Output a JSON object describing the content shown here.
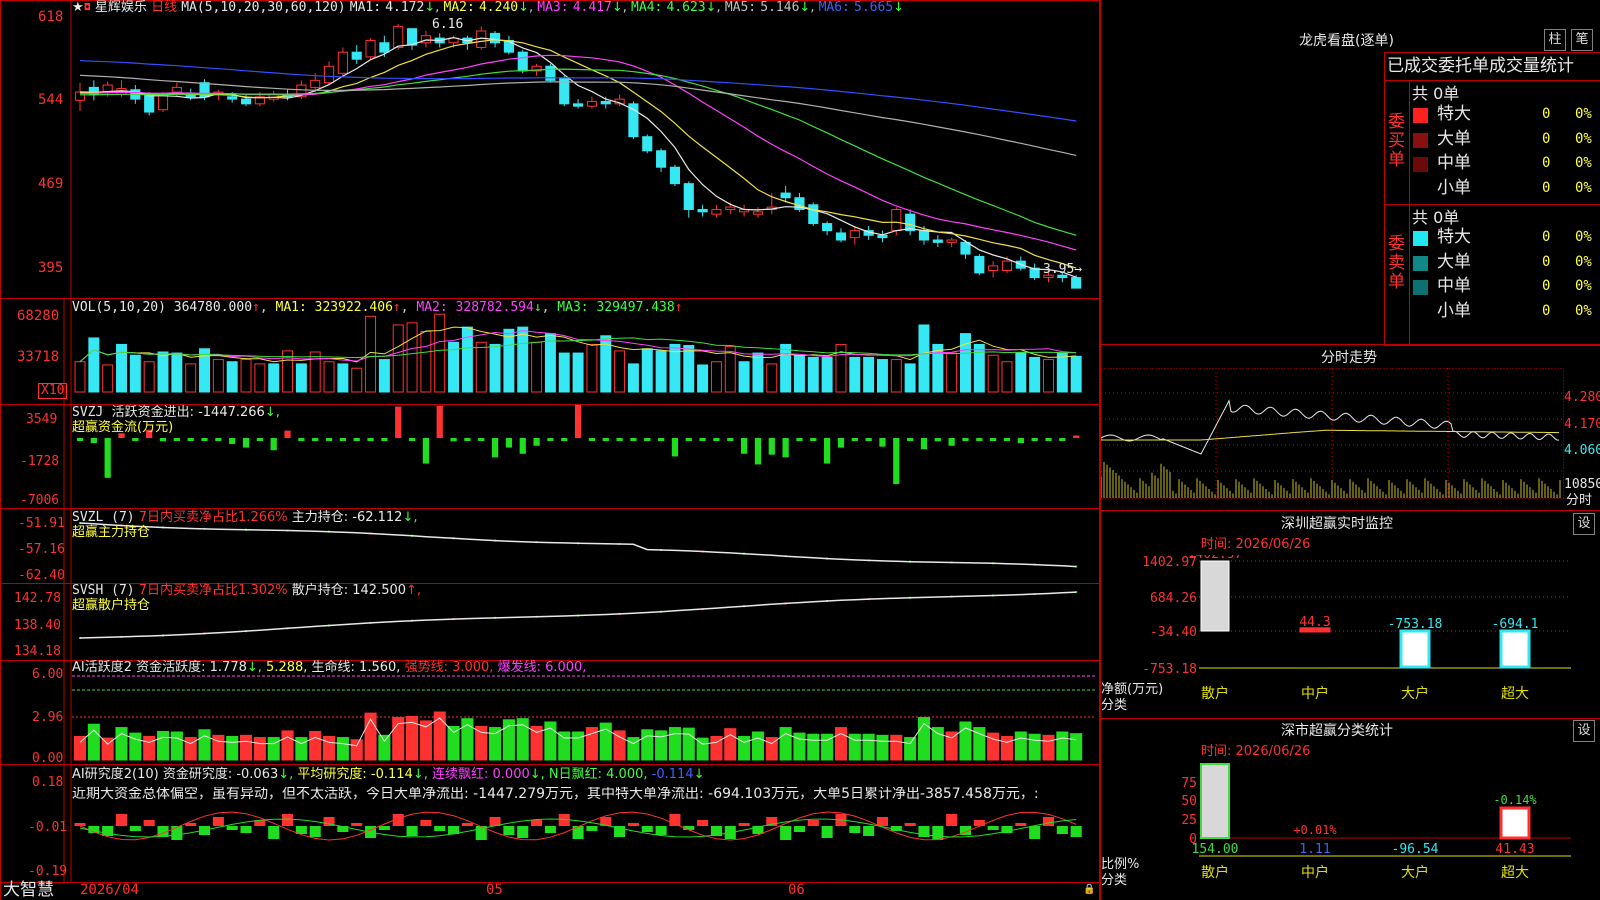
{
  "colors": {
    "up": "#ff3232",
    "down": "#36e8f4",
    "ma1": "#e8e8e8",
    "ma2": "#f0e040",
    "ma3": "#ff40ff",
    "ma4": "#40dd40",
    "ma5": "#b0b0b0",
    "ma6": "#3050ff",
    "grid": "#c00000",
    "bg": "#000000"
  },
  "stock": {
    "name": "星辉娱乐",
    "period": "日线"
  },
  "kline": {
    "ma_label": "MA(5,10,20,30,60,120)",
    "ma": [
      {
        "label": "MA1:",
        "value": "4.172",
        "arrow": "↓"
      },
      {
        "label": "MA2:",
        "value": "4.240",
        "arrow": "↓"
      },
      {
        "label": "MA3:",
        "value": "4.417",
        "arrow": "↓"
      },
      {
        "label": "MA4:",
        "value": "4.623",
        "arrow": "↓"
      },
      {
        "label": "MA5:",
        "value": "5.146",
        "arrow": "↓"
      },
      {
        "label": "MA6:",
        "value": "5.665",
        "arrow": "↓"
      }
    ],
    "high_mark": "6.16",
    "low_mark": "3.95→",
    "y_ticks": [
      "618",
      "544",
      "469",
      "395"
    ]
  },
  "vol": {
    "label": "VOL(5,10,20)",
    "value": "364780.000",
    "arrow": "↑",
    "ma1": "MA1: 323922.406",
    "ma1_arrow": "↑",
    "ma2": "MA2: 328782.594",
    "ma2_arrow": "↓",
    "ma3": "MA3: 329497.438",
    "ma3_arrow": "↑",
    "y_ticks": [
      "68280",
      "33718"
    ],
    "unit": "X10"
  },
  "svzj": {
    "label": "SVZJ",
    "sub": "活跃资金进出: -1447.266",
    "arrow": "↓,",
    "title2": "超赢资金流(万元)",
    "y_ticks": [
      "3549",
      "-1728",
      "-7006"
    ]
  },
  "svzl": {
    "label": "SVZL (7)",
    "text1": "7日内买卖净占比1.266%",
    "text2": "主力持仓: -62.112",
    "arrow": "↓,",
    "title2": "超赢主力持仓",
    "y_ticks": [
      "-51.91",
      "-57.16",
      "-62.40"
    ]
  },
  "svsh": {
    "label": "SVSH (7)",
    "text1": "7日内买卖净占比1.302%",
    "text2": "散户持仓: 142.500",
    "arrow": "↑,",
    "title2": "超赢散户持仓",
    "y_ticks": [
      "142.78",
      "138.40",
      "134.18"
    ]
  },
  "ai_act": {
    "label": "AI活跃度2",
    "t1": "资金活跃度: 1.778",
    "a1": "↓,",
    "t2": "5.288,",
    "t3": "生命线: 1.560,",
    "t4": "强势线: 3.000,",
    "t5": "爆发线: 6.000,",
    "y_ticks": [
      "6.00",
      "2.96",
      "0.00"
    ]
  },
  "ai_res": {
    "label": "AI研究度2(10)",
    "t1": "资金研究度: -0.063",
    "a1": "↓,",
    "t2": "平均研究度: -0.114",
    "a2": "↓,",
    "t3": "连续飘红: 0.000",
    "a3": "↓,",
    "t4": "N日飘红: 4.000,",
    "t5": "-0.114",
    "a5": "↓",
    "desc": "近期大资金总体偏空，虽有异动，但不太活跃，今日大单净流出: -1447.279万元，其中特大单净流出: -694.103万元，大单5日累计净出-3857.458万元，:",
    "y_ticks": [
      "0.18",
      "-0.01",
      "-0.19"
    ]
  },
  "footer": {
    "brand": "大智慧",
    "dates": [
      "2026/04",
      "05",
      "06"
    ]
  },
  "right": {
    "dragon_title": "龙虎看盘(逐单)",
    "btn1": "柱",
    "btn2": "笔",
    "tabs": [
      "已成交",
      "委托单",
      "成交量统计"
    ],
    "buy": {
      "side": "委买单",
      "count": "共 0单",
      "rows": [
        {
          "label": "特大",
          "qty": "0",
          "pct": "0%",
          "color": "#ff2020"
        },
        {
          "label": "大单",
          "qty": "0",
          "pct": "0%",
          "color": "#8a1010"
        },
        {
          "label": "中单",
          "qty": "0",
          "pct": "0%",
          "color": "#6a0a0a"
        },
        {
          "label": "小单",
          "qty": "0",
          "pct": "0%",
          "color": "#000000"
        }
      ]
    },
    "sell": {
      "side": "委卖单",
      "count": "共 0单",
      "rows": [
        {
          "label": "特大",
          "qty": "0",
          "pct": "0%",
          "color": "#20e8f0"
        },
        {
          "label": "大单",
          "qty": "0",
          "pct": "0%",
          "color": "#108888"
        },
        {
          "label": "中单",
          "qty": "0",
          "pct": "0%",
          "color": "#0e7070"
        },
        {
          "label": "小单",
          "qty": "0",
          "pct": "0%",
          "color": "#000000"
        }
      ]
    },
    "intraday": {
      "title": "分时走势",
      "prices": [
        "4.280",
        "4.170",
        "4.060"
      ],
      "vol_label": "10850",
      "unit": "分时"
    },
    "sz_monitor": {
      "title": "深圳超赢实时监控",
      "btn": "设",
      "date": "时间: 2026/06/26",
      "y_ticks": [
        "1402.97",
        "684.26",
        "-34.40",
        "-753.18"
      ],
      "labels": [
        "1402.97",
        "44.3",
        "-753.18",
        "-694.1"
      ],
      "cats": [
        "散户",
        "中户",
        "大户",
        "超大"
      ],
      "axis_label1": "净额(万元)",
      "axis_label2": "分类"
    },
    "sz_class": {
      "title": "深市超赢分类统计",
      "btn": "设",
      "date": "时间: 2026/06/26",
      "y_ticks": [
        "75",
        "50",
        "25",
        "0"
      ],
      "pcts": [
        "+0.01%",
        "-0.14%"
      ],
      "values": [
        "154.00",
        "1.11",
        "-96.54",
        "41.43"
      ],
      "cats": [
        "散户",
        "中户",
        "大户",
        "超大"
      ],
      "axis_label1": "比例%",
      "axis_label2": "分类"
    }
  },
  "chart_data": [
    {
      "type": "candlestick",
      "title": "星辉娱乐 日线",
      "y_ticks": [
        618,
        544,
        469,
        395
      ],
      "series": [
        {
          "name": "MA1"
        },
        {
          "name": "MA2"
        },
        {
          "name": "MA3"
        },
        {
          "name": "MA4"
        },
        {
          "name": "MA5"
        },
        {
          "name": "MA6"
        }
      ],
      "high": 6.16,
      "low": 3.95,
      "candles": [
        [
          5.55,
          5.62,
          5.7,
          5.46
        ],
        [
          5.66,
          5.6,
          5.72,
          5.55
        ],
        [
          5.62,
          5.68,
          5.71,
          5.58
        ],
        [
          5.6,
          5.65,
          5.72,
          5.58
        ],
        [
          5.64,
          5.56,
          5.68,
          5.52
        ],
        [
          5.6,
          5.45,
          5.62,
          5.42
        ],
        [
          5.47,
          5.6,
          5.62,
          5.45
        ],
        [
          5.62,
          5.66,
          5.7,
          5.58
        ],
        [
          5.6,
          5.58,
          5.65,
          5.55
        ],
        [
          5.7,
          5.58,
          5.73,
          5.55
        ],
        [
          5.6,
          5.62,
          5.64,
          5.55
        ],
        [
          5.58,
          5.56,
          5.62,
          5.53
        ],
        [
          5.56,
          5.52,
          5.6,
          5.5
        ],
        [
          5.52,
          5.58,
          5.62,
          5.5
        ],
        [
          5.56,
          5.6,
          5.63,
          5.54
        ],
        [
          5.6,
          5.58,
          5.64,
          5.55
        ],
        [
          5.58,
          5.68,
          5.72,
          5.56
        ],
        [
          5.66,
          5.72,
          5.78,
          5.62
        ],
        [
          5.7,
          5.84,
          5.88,
          5.68
        ],
        [
          5.78,
          5.96,
          6.0,
          5.76
        ],
        [
          5.96,
          5.9,
          6.02,
          5.86
        ],
        [
          5.92,
          6.06,
          6.08,
          5.9
        ],
        [
          6.04,
          5.96,
          6.1,
          5.92
        ],
        [
          6.0,
          6.18,
          6.2,
          5.98
        ],
        [
          6.16,
          6.02,
          6.16,
          5.98
        ],
        [
          6.04,
          6.1,
          6.14,
          6.0
        ],
        [
          6.08,
          6.04,
          6.12,
          6.0
        ],
        [
          6.04,
          6.08,
          6.1,
          6.0
        ],
        [
          6.08,
          6.04,
          6.1,
          5.98
        ],
        [
          6.0,
          6.14,
          6.18,
          5.98
        ],
        [
          6.12,
          6.04,
          6.14,
          6.0
        ],
        [
          6.06,
          5.96,
          6.1,
          5.94
        ],
        [
          5.96,
          5.8,
          5.98,
          5.78
        ],
        [
          5.8,
          5.84,
          5.86,
          5.76
        ],
        [
          5.84,
          5.72,
          5.86,
          5.7
        ],
        [
          5.74,
          5.52,
          5.76,
          5.5
        ],
        [
          5.52,
          5.5,
          5.56,
          5.48
        ],
        [
          5.5,
          5.54,
          5.58,
          5.48
        ],
        [
          5.54,
          5.52,
          5.58,
          5.48
        ],
        [
          5.52,
          5.56,
          5.6,
          5.5
        ],
        [
          5.52,
          5.24,
          5.54,
          5.22
        ],
        [
          5.24,
          5.12,
          5.26,
          5.1
        ],
        [
          5.12,
          4.98,
          5.14,
          4.94
        ],
        [
          4.98,
          4.84,
          5.0,
          4.82
        ],
        [
          4.84,
          4.62,
          4.86,
          4.55
        ],
        [
          4.62,
          4.6,
          4.66,
          4.56
        ],
        [
          4.58,
          4.62,
          4.66,
          4.55
        ],
        [
          4.62,
          4.64,
          4.68,
          4.58
        ],
        [
          4.6,
          4.62,
          4.66,
          4.56
        ],
        [
          4.58,
          4.6,
          4.64,
          4.55
        ],
        [
          4.62,
          4.64,
          4.76,
          4.58
        ],
        [
          4.76,
          4.72,
          4.82,
          4.68
        ],
        [
          4.72,
          4.62,
          4.76,
          4.6
        ],
        [
          4.66,
          4.5,
          4.68,
          4.48
        ],
        [
          4.5,
          4.44,
          4.52,
          4.4
        ],
        [
          4.42,
          4.36,
          4.46,
          4.34
        ],
        [
          4.38,
          4.44,
          4.48,
          4.32
        ],
        [
          4.44,
          4.4,
          4.48,
          4.36
        ],
        [
          4.4,
          4.38,
          4.44,
          4.34
        ],
        [
          4.44,
          4.62,
          4.64,
          4.4
        ],
        [
          4.58,
          4.44,
          4.62,
          4.4
        ],
        [
          4.44,
          4.36,
          4.48,
          4.32
        ],
        [
          4.36,
          4.34,
          4.4,
          4.3
        ],
        [
          4.34,
          4.36,
          4.38,
          4.3
        ],
        [
          4.34,
          4.24,
          4.36,
          4.2
        ],
        [
          4.22,
          4.08,
          4.24,
          4.06
        ],
        [
          4.1,
          4.14,
          4.18,
          4.04
        ],
        [
          4.1,
          4.18,
          4.22,
          4.08
        ],
        [
          4.18,
          4.12,
          4.22,
          4.1
        ],
        [
          4.12,
          4.04,
          4.16,
          4.02
        ],
        [
          4.04,
          4.06,
          4.1,
          4.0
        ],
        [
          4.06,
          4.04,
          4.08,
          4.0
        ],
        [
          4.04,
          3.95,
          4.06,
          3.95
        ]
      ]
    },
    {
      "type": "bar",
      "title": "VOL(5,10,20)",
      "y_ticks": [
        68280,
        33718
      ],
      "values": [
        2.8,
        5.0,
        2.5,
        4.4,
        3.4,
        2.8,
        3.7,
        3.6,
        2.6,
        4.0,
        3.0,
        2.8,
        3.0,
        2.6,
        2.6,
        3.8,
        2.6,
        3.7,
        2.8,
        2.6,
        2.2,
        7.0,
        3.0,
        6.2,
        6.4,
        5.6,
        7.2,
        4.6,
        6.0,
        4.6,
        4.4,
        5.8,
        6.0,
        4.6,
        5.4,
        3.6,
        3.6,
        4.4,
        5.2,
        3.8,
        2.6,
        4.0,
        3.8,
        4.4,
        4.3,
        2.5,
        2.8,
        4.2,
        2.8,
        3.6,
        2.6,
        4.4,
        3.4,
        3.2,
        3.2,
        4.4,
        3.2,
        3.2,
        3.0,
        3.0,
        2.6,
        6.2,
        4.4,
        3.6,
        5.4,
        4.4,
        3.4,
        2.8,
        3.6,
        3.2,
        3.0,
        3.6,
        3.3
      ],
      "up": [
        1,
        0,
        1,
        0,
        0,
        1,
        0,
        0,
        1,
        0,
        1,
        0,
        1,
        1,
        0,
        1,
        0,
        1,
        1,
        0,
        1,
        1,
        0,
        1,
        1,
        1,
        1,
        0,
        0,
        1,
        0,
        0,
        0,
        1,
        0,
        0,
        0,
        1,
        0,
        1,
        0,
        0,
        0,
        0,
        0,
        0,
        1,
        1,
        0,
        0,
        1,
        0,
        0,
        0,
        0,
        1,
        0,
        0,
        0,
        1,
        0,
        0,
        0,
        1,
        0,
        0,
        1,
        1,
        0,
        0,
        1,
        0,
        0
      ]
    },
    {
      "type": "bar",
      "title": "超赢资金流(万元)",
      "y_ticks": [
        3549,
        -1728,
        -7006
      ],
      "values": [
        -1728,
        -2300,
        -6200,
        -1200,
        -1728,
        -800,
        -2100,
        -1728,
        -1728,
        -1728,
        -1728,
        -2400,
        -2800,
        -1728,
        -3100,
        -900,
        -1728,
        -1728,
        -1728,
        -1728,
        -1728,
        -1728,
        -1728,
        1800,
        -1728,
        -4600,
        1900,
        -2100,
        -1728,
        -1728,
        -3900,
        -2800,
        -3500,
        -2600,
        -1728,
        -1728,
        2000,
        -1728,
        -1728,
        -1728,
        -1728,
        -1728,
        -1728,
        -3800,
        -2000,
        -1728,
        -1728,
        -1728,
        -3500,
        -4700,
        -3600,
        -3900,
        -1728,
        -1728,
        -4600,
        -2800,
        -1728,
        -1728,
        -2700,
        -6900,
        -1728,
        -3000,
        -2100,
        -2600,
        -1728,
        -1728,
        -1728,
        -1728,
        -2300,
        -1728,
        -1728,
        -1728,
        -1447
      ]
    },
    {
      "type": "line",
      "title": "超赢主力持仓",
      "y_ticks": [
        -51.91,
        -57.16,
        -62.4
      ]
    },
    {
      "type": "line",
      "title": "超赢散户持仓",
      "y_ticks": [
        142.78,
        138.4,
        134.18
      ]
    },
    {
      "type": "bar",
      "title": "AI活跃度2",
      "y_ticks": [
        6.0,
        2.96,
        0.0
      ]
    },
    {
      "type": "bar",
      "title": "AI研究度2(10)",
      "y_ticks": [
        0.18,
        -0.01,
        -0.19
      ]
    },
    {
      "type": "bar",
      "title": "深圳超赢实时监控",
      "categories": [
        "散户",
        "中户",
        "大户",
        "超大"
      ],
      "values": [
        1402.97,
        44.3,
        -753.18,
        -694.1
      ],
      "y_ticks": [
        1402.97,
        684.26,
        -34.4,
        -753.18
      ]
    },
    {
      "type": "bar",
      "title": "深市超赢分类统计",
      "categories": [
        "散户",
        "中户",
        "大户",
        "超大"
      ],
      "values": [
        154.0,
        1.11,
        -96.54,
        41.43
      ],
      "pcts": [
        "+0.01%",
        "-0.14%"
      ],
      "y_ticks": [
        75,
        50,
        25,
        0
      ]
    }
  ]
}
